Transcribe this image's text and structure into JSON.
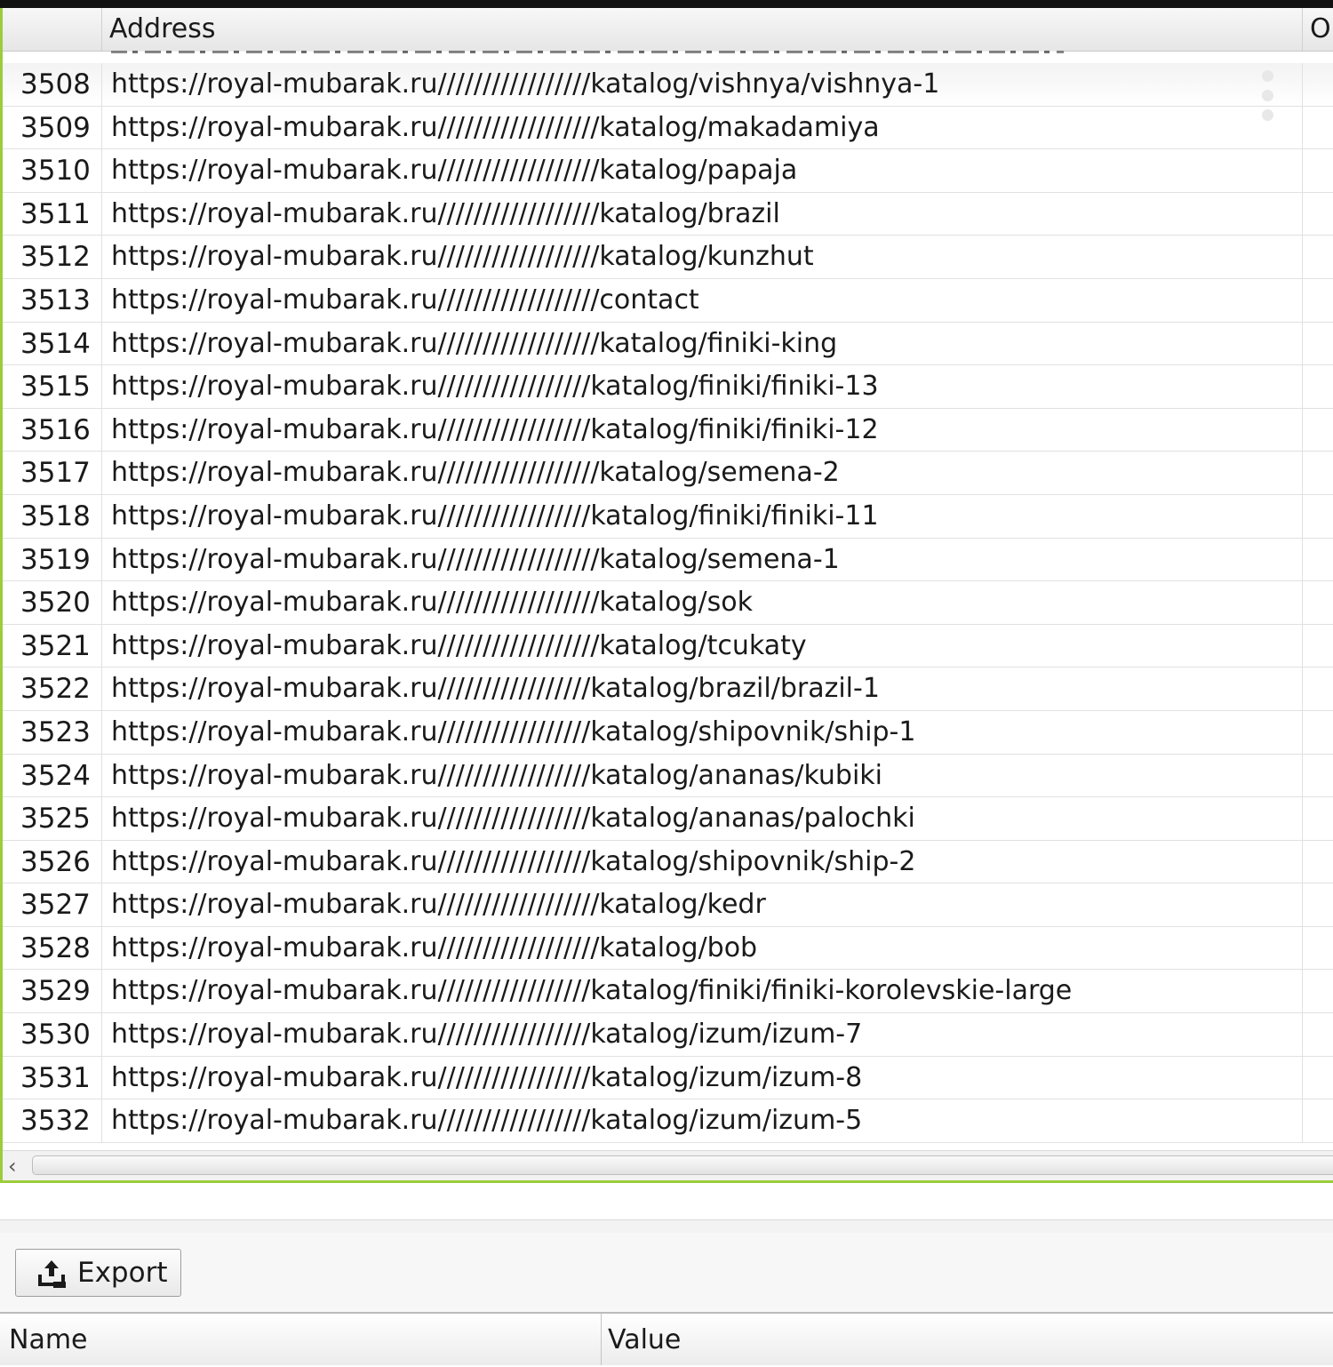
{
  "table": {
    "columns": {
      "number": "",
      "address": "Address",
      "next": "O"
    },
    "rows": [
      {
        "num": "3508",
        "address": "https://royal-mubarak.ru/////////////////katalog/vishnya/vishnya-1"
      },
      {
        "num": "3509",
        "address": "https://royal-mubarak.ru//////////////////katalog/makadamiya"
      },
      {
        "num": "3510",
        "address": "https://royal-mubarak.ru//////////////////katalog/papaja"
      },
      {
        "num": "3511",
        "address": "https://royal-mubarak.ru//////////////////katalog/brazil"
      },
      {
        "num": "3512",
        "address": "https://royal-mubarak.ru//////////////////katalog/kunzhut"
      },
      {
        "num": "3513",
        "address": "https://royal-mubarak.ru//////////////////contact"
      },
      {
        "num": "3514",
        "address": "https://royal-mubarak.ru//////////////////katalog/finiki-king"
      },
      {
        "num": "3515",
        "address": "https://royal-mubarak.ru/////////////////katalog/finiki/finiki-13"
      },
      {
        "num": "3516",
        "address": "https://royal-mubarak.ru/////////////////katalog/finiki/finiki-12"
      },
      {
        "num": "3517",
        "address": "https://royal-mubarak.ru//////////////////katalog/semena-2"
      },
      {
        "num": "3518",
        "address": "https://royal-mubarak.ru/////////////////katalog/finiki/finiki-11"
      },
      {
        "num": "3519",
        "address": "https://royal-mubarak.ru//////////////////katalog/semena-1"
      },
      {
        "num": "3520",
        "address": "https://royal-mubarak.ru//////////////////katalog/sok"
      },
      {
        "num": "3521",
        "address": "https://royal-mubarak.ru//////////////////katalog/tcukaty"
      },
      {
        "num": "3522",
        "address": "https://royal-mubarak.ru/////////////////katalog/brazil/brazil-1"
      },
      {
        "num": "3523",
        "address": "https://royal-mubarak.ru/////////////////katalog/shipovnik/ship-1"
      },
      {
        "num": "3524",
        "address": "https://royal-mubarak.ru/////////////////katalog/ananas/kubiki"
      },
      {
        "num": "3525",
        "address": "https://royal-mubarak.ru/////////////////katalog/ananas/palochki"
      },
      {
        "num": "3526",
        "address": "https://royal-mubarak.ru/////////////////katalog/shipovnik/ship-2"
      },
      {
        "num": "3527",
        "address": "https://royal-mubarak.ru//////////////////katalog/kedr"
      },
      {
        "num": "3528",
        "address": "https://royal-mubarak.ru//////////////////katalog/bob"
      },
      {
        "num": "3529",
        "address": "https://royal-mubarak.ru/////////////////katalog/finiki/finiki-korolevskie-large"
      },
      {
        "num": "3530",
        "address": "https://royal-mubarak.ru/////////////////katalog/izum/izum-7"
      },
      {
        "num": "3531",
        "address": "https://royal-mubarak.ru/////////////////katalog/izum/izum-8"
      },
      {
        "num": "3532",
        "address": "https://royal-mubarak.ru/////////////////katalog/izum/izum-5"
      }
    ]
  },
  "scrollbar": {
    "left_arrow_icon": "chevron-left-icon",
    "left_arrow_glyph": "‹"
  },
  "toolbar": {
    "export_label": "Export",
    "export_icon": "export-icon"
  },
  "properties": {
    "name_header": "Name",
    "value_header": "Value"
  },
  "colors": {
    "accent_border": "#9ccc3c",
    "top_bar": "#111111"
  }
}
